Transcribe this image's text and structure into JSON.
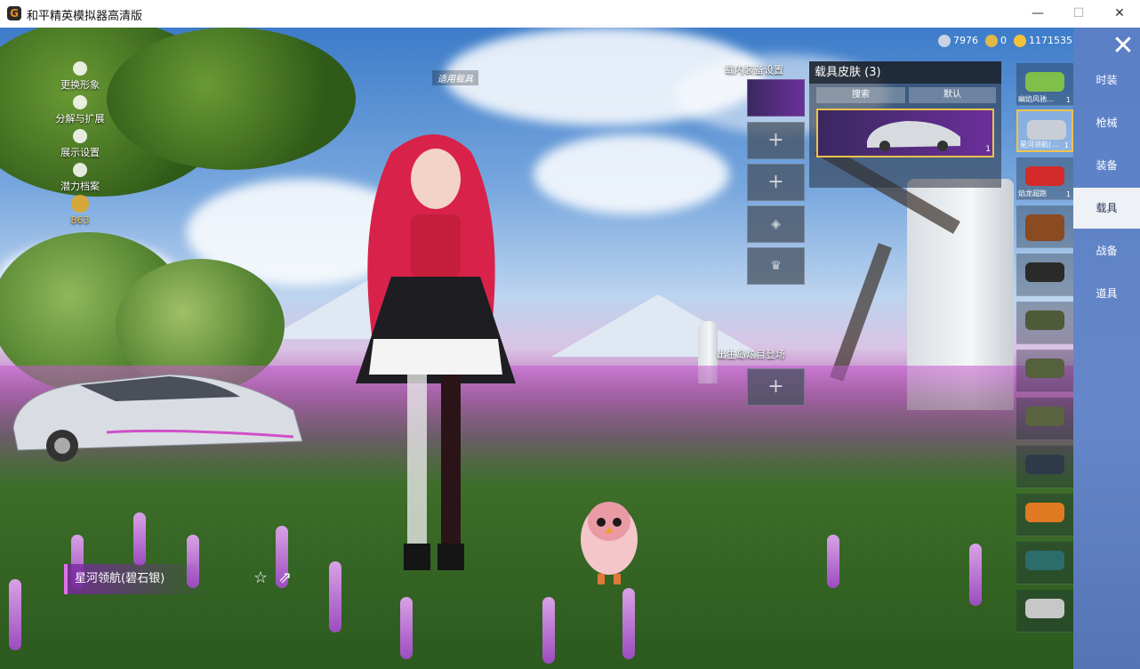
{
  "window": {
    "title": "和平精英模拟器高清版",
    "app_icon": "G",
    "controls": {
      "minimize": "—",
      "maximize": "☐",
      "close": "✕"
    }
  },
  "left_menu": [
    {
      "label": "更换形象",
      "icon": "person-icon"
    },
    {
      "label": "分解与扩展",
      "icon": "puzzle-icon"
    },
    {
      "label": "展示设置",
      "icon": "eye-icon"
    },
    {
      "label": "潜力档案",
      "icon": "flame-icon"
    }
  ],
  "level_badge": {
    "value": "863"
  },
  "apply_vehicle": {
    "label": "适用载具"
  },
  "slots": {
    "top_label": "载内装备设置",
    "spawn_label": "出生岛炫目登场",
    "plus": "+"
  },
  "currency": [
    {
      "value": "7976",
      "icon": "diamond-icon"
    },
    {
      "value": "0",
      "icon": "coupon-icon"
    },
    {
      "value": "1171535",
      "icon": "gold-coin-icon"
    }
  ],
  "skin_panel": {
    "title": "载具皮肤 (3)",
    "search_placeholder": "搜索",
    "sort": "默认",
    "card_count": "1"
  },
  "vehicles": [
    {
      "name": "幽焰风驰…",
      "count": "1"
    },
    {
      "name": "星河领航(…",
      "count": "1"
    },
    {
      "name": "焰龙超跑",
      "count": "1"
    },
    {
      "name": "",
      "count": ""
    },
    {
      "name": "",
      "count": ""
    },
    {
      "name": "",
      "count": ""
    },
    {
      "name": "",
      "count": ""
    },
    {
      "name": "",
      "count": ""
    },
    {
      "name": "",
      "count": ""
    },
    {
      "name": "",
      "count": ""
    },
    {
      "name": "",
      "count": ""
    },
    {
      "name": "",
      "count": ""
    }
  ],
  "categories": [
    {
      "label": "时装"
    },
    {
      "label": "枪械"
    },
    {
      "label": "装备"
    },
    {
      "label": "载具",
      "selected": true
    },
    {
      "label": "战备"
    },
    {
      "label": "道具"
    }
  ],
  "vehicle_name": "星河领航(碧石银)",
  "close_icon": "✕",
  "colors": {
    "category_panel": "#5a7fc6",
    "highlight": "#f0c24b",
    "name_tag": "#7828a0"
  }
}
